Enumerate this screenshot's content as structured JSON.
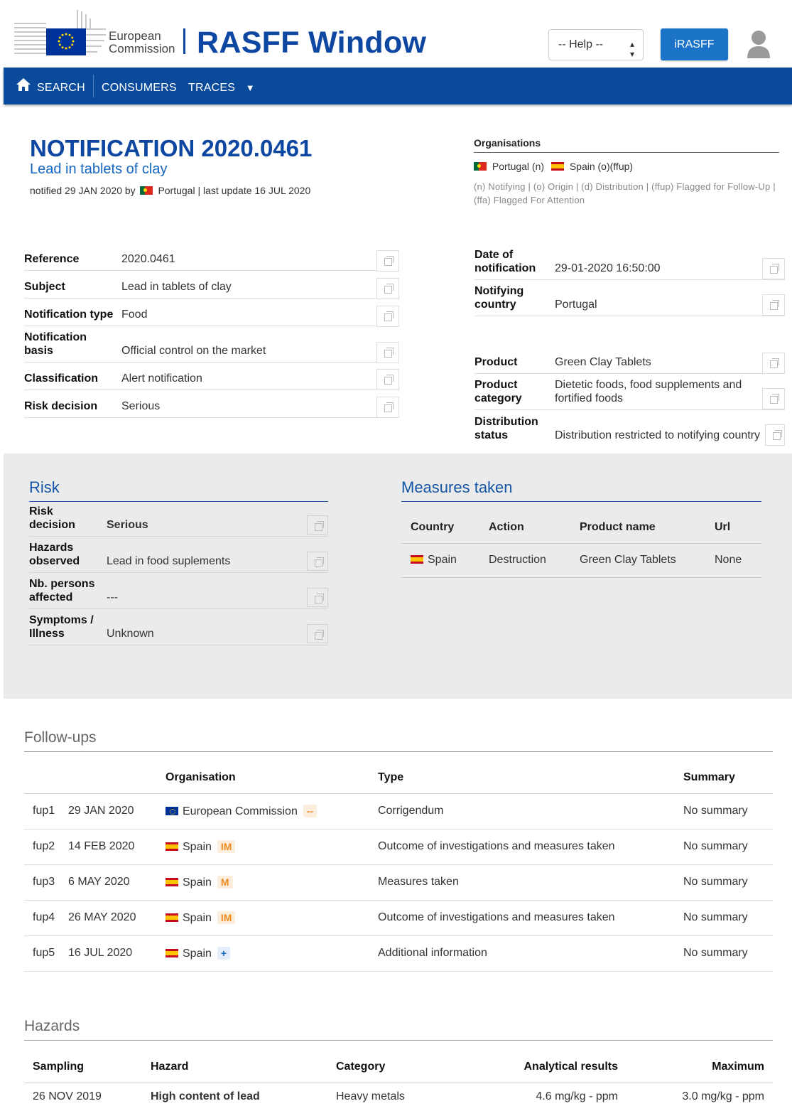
{
  "header": {
    "ec_line1": "European",
    "ec_line2": "Commission",
    "app_title": "RASFF Window",
    "help_label": "-- Help --",
    "irasff_label": "iRASFF"
  },
  "nav": {
    "search": "SEARCH",
    "consumers": "CONSUMERS",
    "traces": "TRACES"
  },
  "notification": {
    "title": "NOTIFICATION 2020.0461",
    "subtitle": "Lead in tablets of clay",
    "meta_prefix": "notified 29 JAN 2020 by",
    "meta_suffix": "Portugal | last update 16 JUL 2020"
  },
  "organisations": {
    "heading": "Organisations",
    "portugal": "Portugal (n)",
    "spain": "Spain (o)(ffup)",
    "legend": "(n) Notifying | (o) Origin | (d) Distribution | (ffup) Flagged for Follow-Up | (ffa) Flagged For Attention"
  },
  "fields_left": [
    {
      "label": "Reference",
      "value": "2020.0461"
    },
    {
      "label": "Subject",
      "value": "Lead in tablets of clay"
    },
    {
      "label": "Notification type",
      "value": "Food"
    },
    {
      "label": "Notification basis",
      "value": "Official control on the market"
    },
    {
      "label": "Classification",
      "value": "Alert notification"
    },
    {
      "label": "Risk decision",
      "value": "Serious"
    }
  ],
  "fields_right": [
    {
      "label": "Date of notification",
      "value": "29-01-2020 16:50:00"
    },
    {
      "label": "Notifying country",
      "value": "Portugal"
    },
    {
      "label": "Product",
      "value": "Green Clay Tablets"
    },
    {
      "label": "Product category",
      "value": "Dietetic foods, food supplements and fortified foods"
    },
    {
      "label": "Distribution status",
      "value": "Distribution restricted to notifying country"
    }
  ],
  "risk": {
    "title": "Risk",
    "rows": [
      {
        "label": "Risk decision",
        "value": "Serious"
      },
      {
        "label": "Hazards observed",
        "value": "Lead in food suplements"
      },
      {
        "label": "Nb. persons affected",
        "value": "---"
      },
      {
        "label": "Symptoms / Illness",
        "value": "Unknown"
      }
    ]
  },
  "measures": {
    "title": "Measures taken",
    "headers": [
      "Country",
      "Action",
      "Product name",
      "Url"
    ],
    "rows": [
      {
        "country": "Spain",
        "action": "Destruction",
        "product": "Green Clay Tablets",
        "url": "None"
      }
    ]
  },
  "followups": {
    "title": "Follow-ups",
    "headers": [
      "Organisation",
      "Type",
      "Summary"
    ],
    "rows": [
      {
        "id": "fup1",
        "date": "29 JAN 2020",
        "org": "European Commission",
        "badge": "--",
        "type": "Corrigendum",
        "summary": "No summary"
      },
      {
        "id": "fup2",
        "date": "14 FEB 2020",
        "org": "Spain",
        "badge": "IM",
        "type": "Outcome of investigations and measures taken",
        "summary": "No summary"
      },
      {
        "id": "fup3",
        "date": "6 MAY 2020",
        "org": "Spain",
        "badge": "M",
        "type": "Measures taken",
        "summary": "No summary"
      },
      {
        "id": "fup4",
        "date": "26 MAY 2020",
        "org": "Spain",
        "badge": "IM",
        "type": "Outcome of investigations and measures taken",
        "summary": "No summary"
      },
      {
        "id": "fup5",
        "date": "16 JUL 2020",
        "org": "Spain",
        "badge": "+",
        "type": "Additional information",
        "summary": "No summary"
      }
    ]
  },
  "hazards": {
    "title": "Hazards",
    "headers": [
      "Sampling",
      "Hazard",
      "Category",
      "Analytical results",
      "Maximum"
    ],
    "rows": [
      {
        "sampling": "26 NOV 2019",
        "hazard": "High content of lead",
        "category": "Heavy metals",
        "result": "4.6 mg/kg - ppm",
        "maximum": "3.0 mg/kg - ppm"
      }
    ]
  },
  "colors": {
    "brand_blue": "#0e47a1",
    "nav_blue": "#0a4a9b",
    "serious_red": "#d32f2f",
    "badge_orange": "#ef8a1e"
  }
}
